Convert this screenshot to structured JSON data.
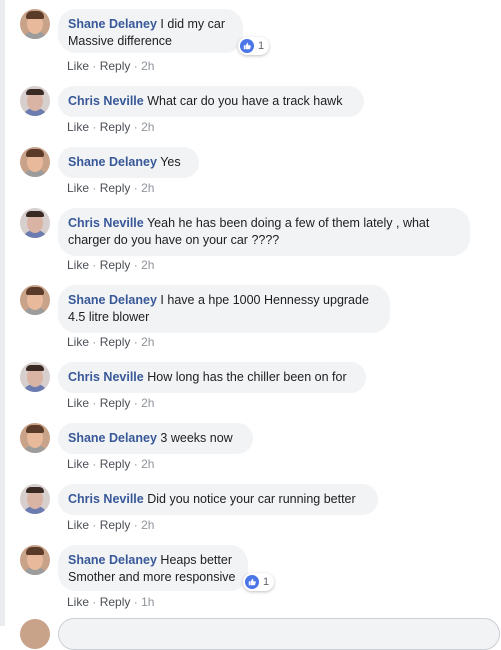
{
  "comments": [
    {
      "author": "Shane Delaney",
      "text": "I did my car",
      "text2": "Massive difference",
      "like": "Like",
      "reply": "Reply",
      "time": "2h",
      "reactions": "1"
    },
    {
      "author": "Chris Neville",
      "text": "What car do you have a track hawk",
      "like": "Like",
      "reply": "Reply",
      "time": "2h"
    },
    {
      "author": "Shane Delaney",
      "text": "Yes",
      "like": "Like",
      "reply": "Reply",
      "time": "2h"
    },
    {
      "author": "Chris Neville",
      "text": "Yeah he has been doing a few of them lately , what",
      "text2": "charger do you have on your car ????",
      "like": "Like",
      "reply": "Reply",
      "time": "2h"
    },
    {
      "author": "Shane Delaney",
      "text": "I have a hpe 1000 Hennessy upgrade",
      "text2": "4.5 litre blower",
      "like": "Like",
      "reply": "Reply",
      "time": "2h"
    },
    {
      "author": "Chris Neville",
      "text": "How long has the chiller been on for",
      "like": "Like",
      "reply": "Reply",
      "time": "2h"
    },
    {
      "author": "Shane Delaney",
      "text": "3 weeks now",
      "like": "Like",
      "reply": "Reply",
      "time": "2h"
    },
    {
      "author": "Chris Neville",
      "text": "Did you notice your car running better",
      "like": "Like",
      "reply": "Reply",
      "time": "2h"
    },
    {
      "author": "Shane Delaney",
      "text": "Heaps better",
      "text2": "Smother and more responsive",
      "like": "Like",
      "reply": "Reply",
      "time": "1h",
      "reactions": "1"
    }
  ],
  "colors": {
    "name": "#385898",
    "bubble": "#f2f3f5",
    "like_badge": "#4a76e8"
  },
  "icons": {
    "reaction": "like-thumb-icon"
  }
}
